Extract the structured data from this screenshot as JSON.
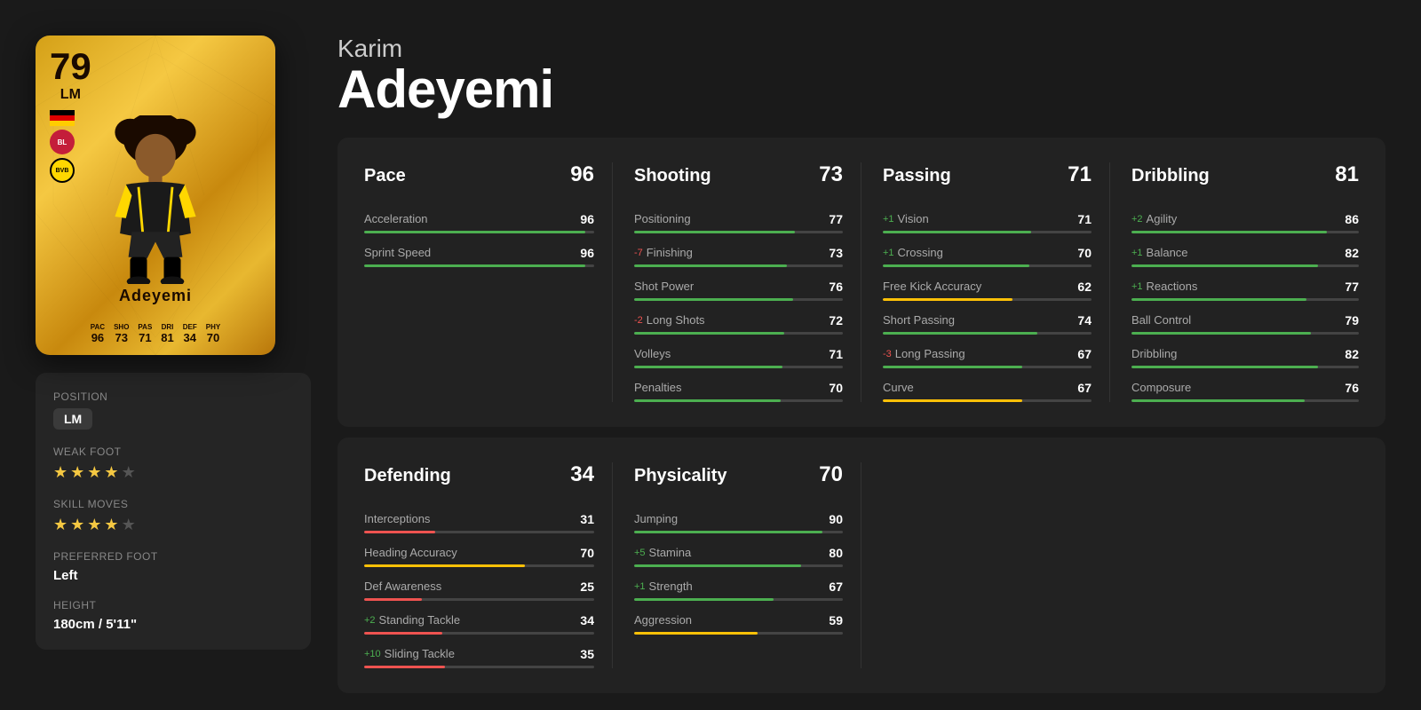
{
  "player": {
    "first_name": "Karim",
    "last_name": "Adeyemi",
    "rating": "79",
    "position": "LM",
    "card_name": "Adeyemi",
    "stats_summary": {
      "PAC": "96",
      "SHO": "73",
      "PAS": "71",
      "DRI": "81",
      "DEF": "34",
      "PHY": "70"
    }
  },
  "info": {
    "position_label": "Position",
    "position_value": "LM",
    "weak_foot_label": "Weak Foot",
    "weak_foot_stars": 4,
    "skill_moves_label": "Skill Moves",
    "skill_moves_stars": 4,
    "preferred_foot_label": "Preferred Foot",
    "preferred_foot_value": "Left",
    "height_label": "Height",
    "height_value": "180cm / 5'11\""
  },
  "categories": {
    "pace": {
      "name": "Pace",
      "value": "96",
      "stats": [
        {
          "name": "Acceleration",
          "value": "96",
          "delta": "",
          "bar_color": "green"
        },
        {
          "name": "Sprint Speed",
          "value": "96",
          "delta": "",
          "bar_color": "green"
        }
      ]
    },
    "shooting": {
      "name": "Shooting",
      "value": "73",
      "stats": [
        {
          "name": "Positioning",
          "value": "77",
          "delta": "",
          "bar_color": "green"
        },
        {
          "name": "Finishing",
          "value": "73",
          "delta": "-7",
          "bar_color": "green"
        },
        {
          "name": "Shot Power",
          "value": "76",
          "delta": "",
          "bar_color": "green"
        },
        {
          "name": "Long Shots",
          "value": "72",
          "delta": "-2",
          "bar_color": "green"
        },
        {
          "name": "Volleys",
          "value": "71",
          "delta": "",
          "bar_color": "green"
        },
        {
          "name": "Penalties",
          "value": "70",
          "delta": "",
          "bar_color": "green"
        }
      ]
    },
    "passing": {
      "name": "Passing",
      "value": "71",
      "stats": [
        {
          "name": "Vision",
          "value": "71",
          "delta": "+1",
          "bar_color": "green"
        },
        {
          "name": "Crossing",
          "value": "70",
          "delta": "+1",
          "bar_color": "green"
        },
        {
          "name": "Free Kick Accuracy",
          "value": "62",
          "delta": "",
          "bar_color": "yellow"
        },
        {
          "name": "Short Passing",
          "value": "74",
          "delta": "",
          "bar_color": "green"
        },
        {
          "name": "Long Passing",
          "value": "67",
          "delta": "-3",
          "bar_color": "green"
        },
        {
          "name": "Curve",
          "value": "67",
          "delta": "",
          "bar_color": "yellow"
        }
      ]
    },
    "dribbling": {
      "name": "Dribbling",
      "value": "81",
      "stats": [
        {
          "name": "Agility",
          "value": "86",
          "delta": "+2",
          "bar_color": "green"
        },
        {
          "name": "Balance",
          "value": "82",
          "delta": "+1",
          "bar_color": "green"
        },
        {
          "name": "Reactions",
          "value": "77",
          "delta": "+1",
          "bar_color": "green"
        },
        {
          "name": "Ball Control",
          "value": "79",
          "delta": "",
          "bar_color": "green"
        },
        {
          "name": "Dribbling",
          "value": "82",
          "delta": "",
          "bar_color": "green"
        },
        {
          "name": "Composure",
          "value": "76",
          "delta": "",
          "bar_color": "green"
        }
      ]
    },
    "defending": {
      "name": "Defending",
      "value": "34",
      "stats": [
        {
          "name": "Interceptions",
          "value": "31",
          "delta": "",
          "bar_color": "red"
        },
        {
          "name": "Heading Accuracy",
          "value": "70",
          "delta": "",
          "bar_color": "yellow"
        },
        {
          "name": "Def Awareness",
          "value": "25",
          "delta": "",
          "bar_color": "red"
        },
        {
          "name": "Standing Tackle",
          "value": "34",
          "delta": "+2",
          "bar_color": "red"
        },
        {
          "name": "Sliding Tackle",
          "value": "35",
          "delta": "+10",
          "bar_color": "red"
        }
      ]
    },
    "physicality": {
      "name": "Physicality",
      "value": "70",
      "stats": [
        {
          "name": "Jumping",
          "value": "90",
          "delta": "",
          "bar_color": "green"
        },
        {
          "name": "Stamina",
          "value": "80",
          "delta": "+5",
          "bar_color": "green"
        },
        {
          "name": "Strength",
          "value": "67",
          "delta": "+1",
          "bar_color": "green"
        },
        {
          "name": "Aggression",
          "value": "59",
          "delta": "",
          "bar_color": "yellow"
        }
      ]
    }
  }
}
